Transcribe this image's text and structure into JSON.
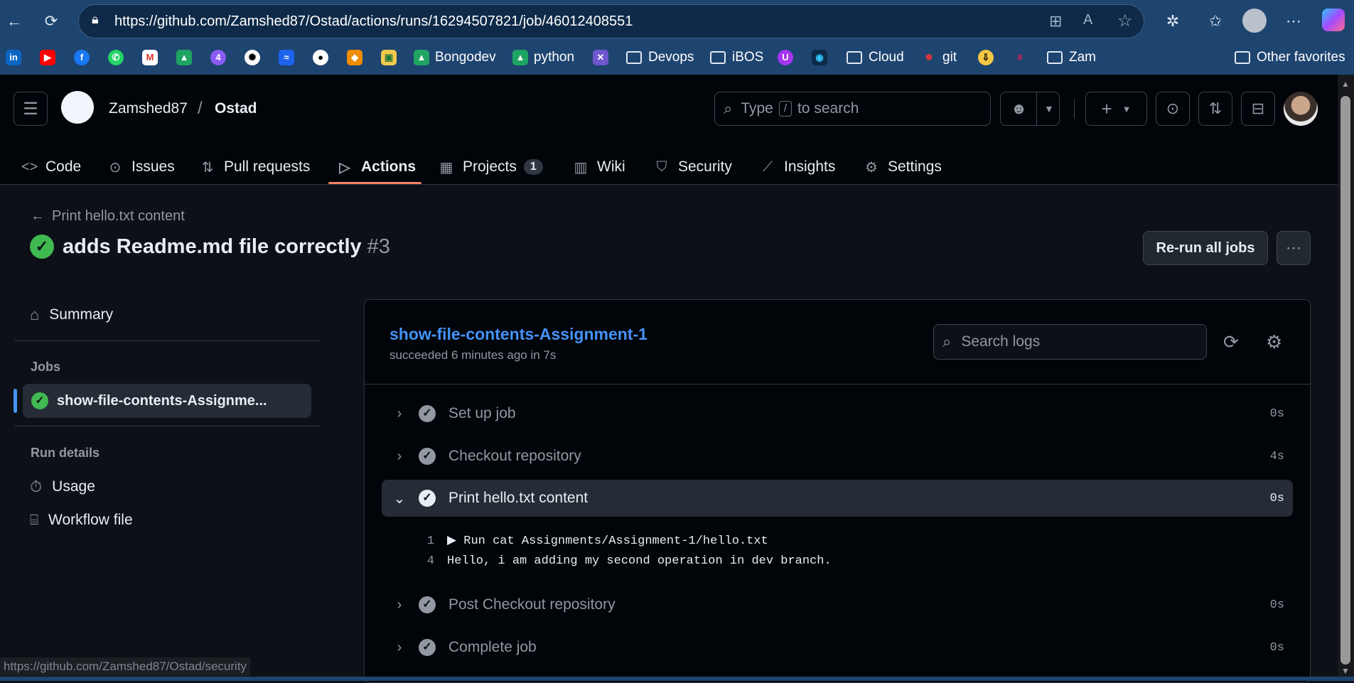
{
  "browser": {
    "url": "https://github.com/Zamshed87/Ostad/actions/runs/16294507821/job/46012408551",
    "bookmarks": [
      "Bongodev",
      "python",
      "Devops",
      "iBOS",
      "Cloud",
      "git",
      "Zam"
    ],
    "other_favorites": "Other favorites",
    "copilot_badge": "4"
  },
  "header": {
    "owner": "Zamshed87",
    "separator": "/",
    "repo": "Ostad",
    "search_prefix": "Type",
    "search_key": "/",
    "search_suffix": "to search"
  },
  "tabs": [
    {
      "label": "Code",
      "icon": "code-icon"
    },
    {
      "label": "Issues",
      "icon": "issue-icon"
    },
    {
      "label": "Pull requests",
      "icon": "pull-request-icon"
    },
    {
      "label": "Actions",
      "icon": "play-icon"
    },
    {
      "label": "Projects",
      "icon": "table-icon",
      "count": "1"
    },
    {
      "label": "Wiki",
      "icon": "book-icon"
    },
    {
      "label": "Security",
      "icon": "shield-icon"
    },
    {
      "label": "Insights",
      "icon": "graph-icon"
    },
    {
      "label": "Settings",
      "icon": "gear-icon"
    }
  ],
  "run": {
    "back_link": "Print hello.txt content",
    "title": "adds Readme.md file correctly",
    "number": "#3",
    "rerun_label": "Re-run all jobs"
  },
  "sidebar": {
    "summary": "Summary",
    "jobs_heading": "Jobs",
    "job_item": "show-file-contents-Assignme...",
    "run_details_heading": "Run details",
    "usage": "Usage",
    "workflow_file": "Workflow file"
  },
  "job": {
    "name": "show-file-contents-Assignment-1",
    "status": "succeeded 6 minutes ago in 7s",
    "search_placeholder": "Search logs",
    "steps": [
      {
        "name": "Set up job",
        "duration": "0s"
      },
      {
        "name": "Checkout repository",
        "duration": "4s"
      },
      {
        "name": "Print hello.txt content",
        "duration": "0s"
      },
      {
        "name": "Post Checkout repository",
        "duration": "0s"
      },
      {
        "name": "Complete job",
        "duration": "0s"
      }
    ],
    "log_lines": [
      {
        "num": "1",
        "text": "▶ Run cat Assignments/Assignment-1/hello.txt"
      },
      {
        "num": "4",
        "text": "Hello, i am adding my second operation in dev branch."
      }
    ]
  },
  "status_url": "https://github.com/Zamshed87/Ostad/security",
  "colors": {
    "accent": "#f78166",
    "success": "#3fb950",
    "link": "#4493f8"
  }
}
